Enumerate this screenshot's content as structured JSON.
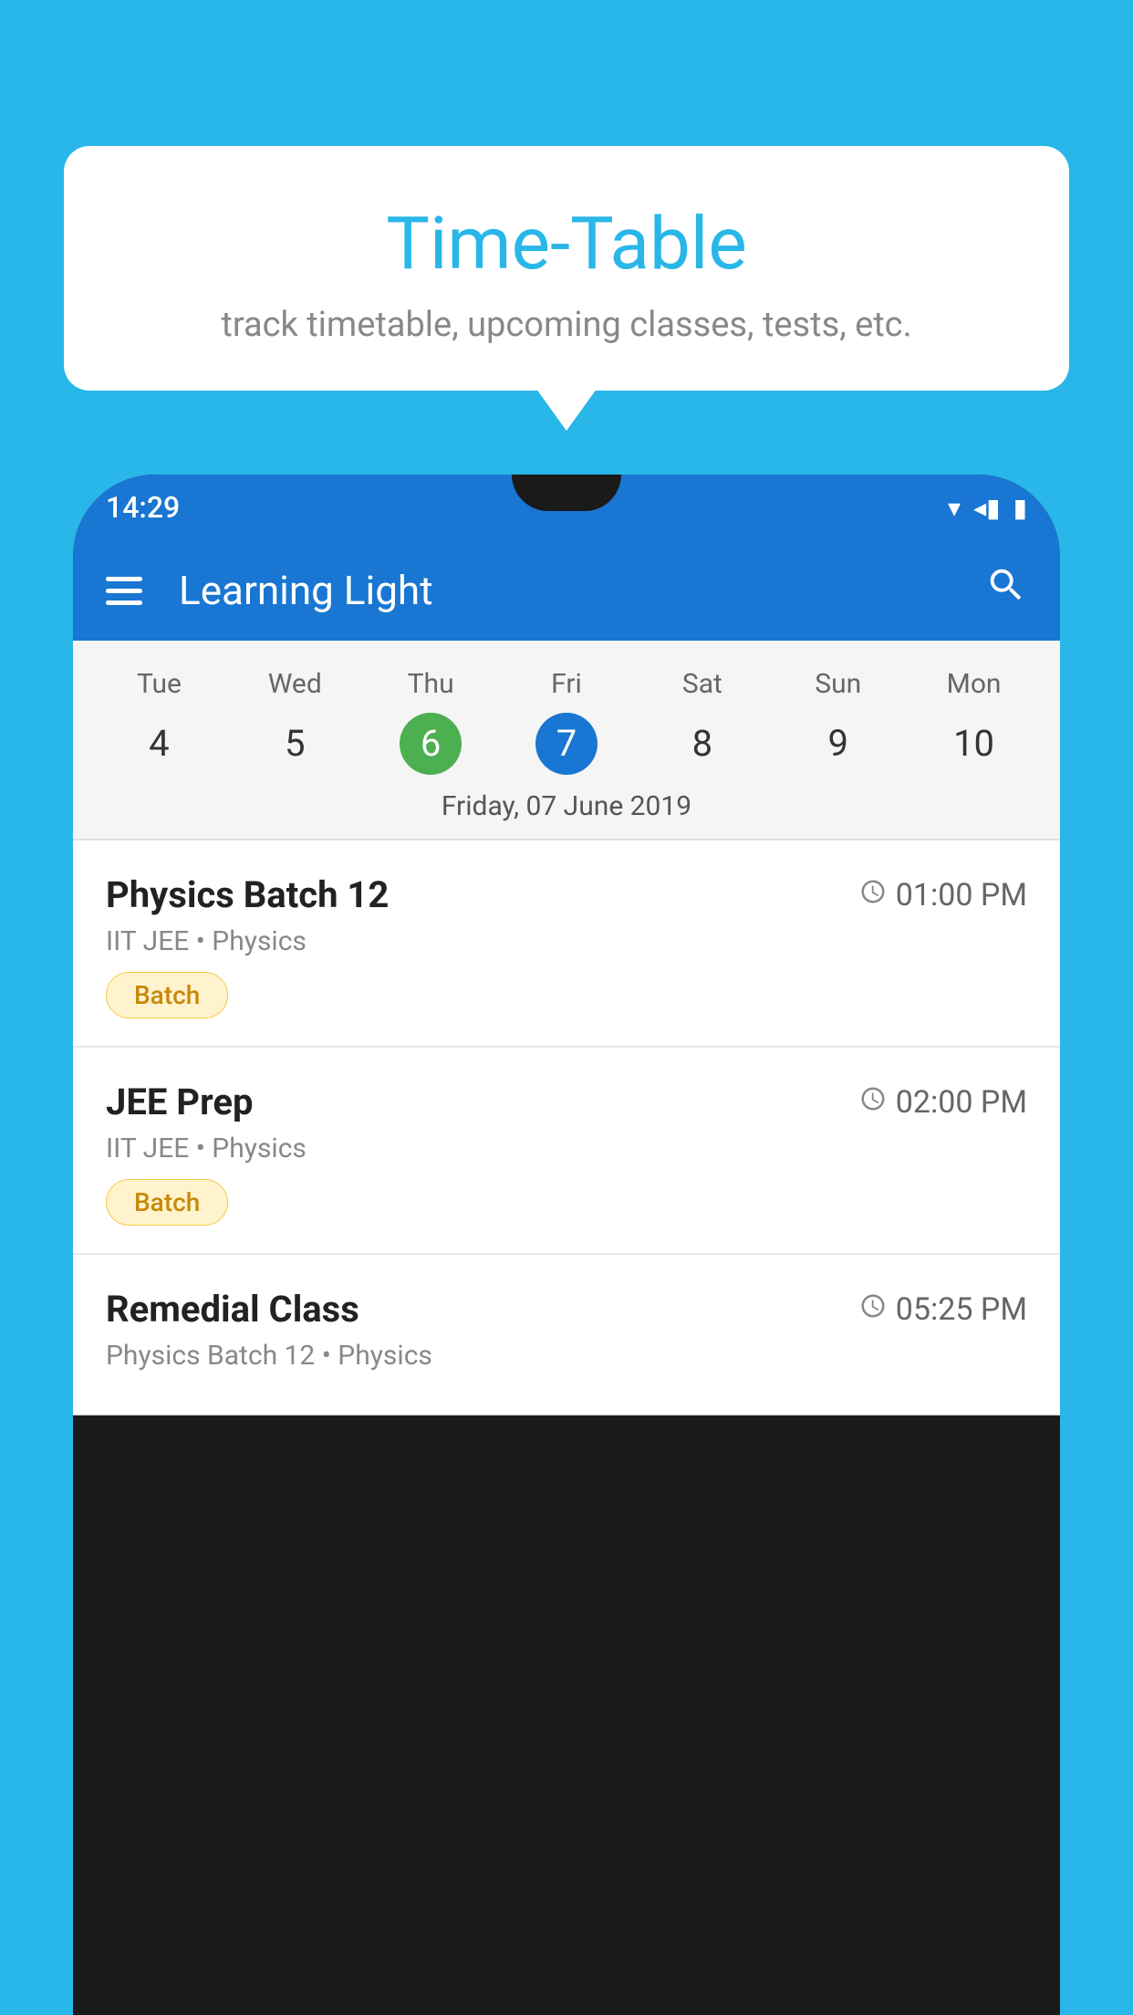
{
  "background_color": "#29b6e8",
  "tooltip": {
    "title": "Time-Table",
    "subtitle": "track timetable, upcoming classes, tests, etc."
  },
  "phone": {
    "status_bar": {
      "time": "14:29",
      "icons": [
        "▾",
        "◂",
        "▮"
      ]
    },
    "app_bar": {
      "title": "Learning Light",
      "search_label": "Search"
    },
    "calendar": {
      "days": [
        {
          "day": "Tue",
          "num": "4"
        },
        {
          "day": "Wed",
          "num": "5"
        },
        {
          "day": "Thu",
          "num": "6",
          "state": "today"
        },
        {
          "day": "Fri",
          "num": "7",
          "state": "selected"
        },
        {
          "day": "Sat",
          "num": "8"
        },
        {
          "day": "Sun",
          "num": "9"
        },
        {
          "day": "Mon",
          "num": "10"
        }
      ],
      "selected_date_label": "Friday, 07 June 2019"
    },
    "schedule_items": [
      {
        "title": "Physics Batch 12",
        "time": "01:00 PM",
        "subtitle": "IIT JEE • Physics",
        "tag": "Batch"
      },
      {
        "title": "JEE Prep",
        "time": "02:00 PM",
        "subtitle": "IIT JEE • Physics",
        "tag": "Batch"
      },
      {
        "title": "Remedial Class",
        "time": "05:25 PM",
        "subtitle": "Physics Batch 12 • Physics",
        "tag": null
      }
    ]
  }
}
